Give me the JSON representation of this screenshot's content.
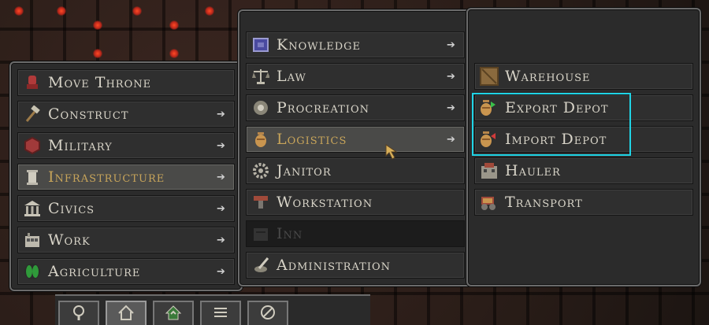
{
  "main_menu": {
    "items": [
      {
        "label": "Move Throne",
        "icon": "throne-icon",
        "arrow": false
      },
      {
        "label": "Construct",
        "icon": "hammer-icon",
        "arrow": true
      },
      {
        "label": "Military",
        "icon": "shield-icon",
        "arrow": true
      },
      {
        "label": "Infrastructure",
        "icon": "pillar-icon",
        "arrow": true,
        "active": true
      },
      {
        "label": "Civics",
        "icon": "civic-building-icon",
        "arrow": true
      },
      {
        "label": "Work",
        "icon": "workshop-icon",
        "arrow": true
      },
      {
        "label": "Agriculture",
        "icon": "leaf-icon",
        "arrow": true
      }
    ]
  },
  "infrastructure_menu": {
    "items": [
      {
        "label": "Knowledge",
        "icon": "book-icon",
        "arrow": true
      },
      {
        "label": "Law",
        "icon": "scales-icon",
        "arrow": true
      },
      {
        "label": "Procreation",
        "icon": "procreation-icon",
        "arrow": true
      },
      {
        "label": "Logistics",
        "icon": "urn-icon",
        "arrow": true,
        "active": true
      },
      {
        "label": "Janitor",
        "icon": "gear-icon",
        "arrow": false
      },
      {
        "label": "Workstation",
        "icon": "anvil-icon",
        "arrow": false
      },
      {
        "label": "Inn",
        "icon": "inn-icon",
        "arrow": false,
        "disabled": true
      },
      {
        "label": "Administration",
        "icon": "quill-icon",
        "arrow": false
      }
    ]
  },
  "logistics_menu": {
    "items": [
      {
        "label": "Warehouse",
        "icon": "crate-icon"
      },
      {
        "label": "Export Depot",
        "icon": "export-urn-icon",
        "highlighted": true
      },
      {
        "label": "Import Depot",
        "icon": "import-urn-icon",
        "highlighted": true
      },
      {
        "label": "Hauler",
        "icon": "hauler-icon"
      },
      {
        "label": "Transport",
        "icon": "cart-icon"
      }
    ]
  },
  "toolbar": {
    "buttons": [
      {
        "icon": "magnifier-icon"
      },
      {
        "icon": "house-icon",
        "active": true
      },
      {
        "icon": "house-upgrade-icon"
      },
      {
        "icon": "list-icon"
      },
      {
        "icon": "cancel-icon"
      }
    ]
  },
  "colors": {
    "highlight": "#20d4e6",
    "active_text": "#c7a45a",
    "text": "#d8d4c8"
  }
}
